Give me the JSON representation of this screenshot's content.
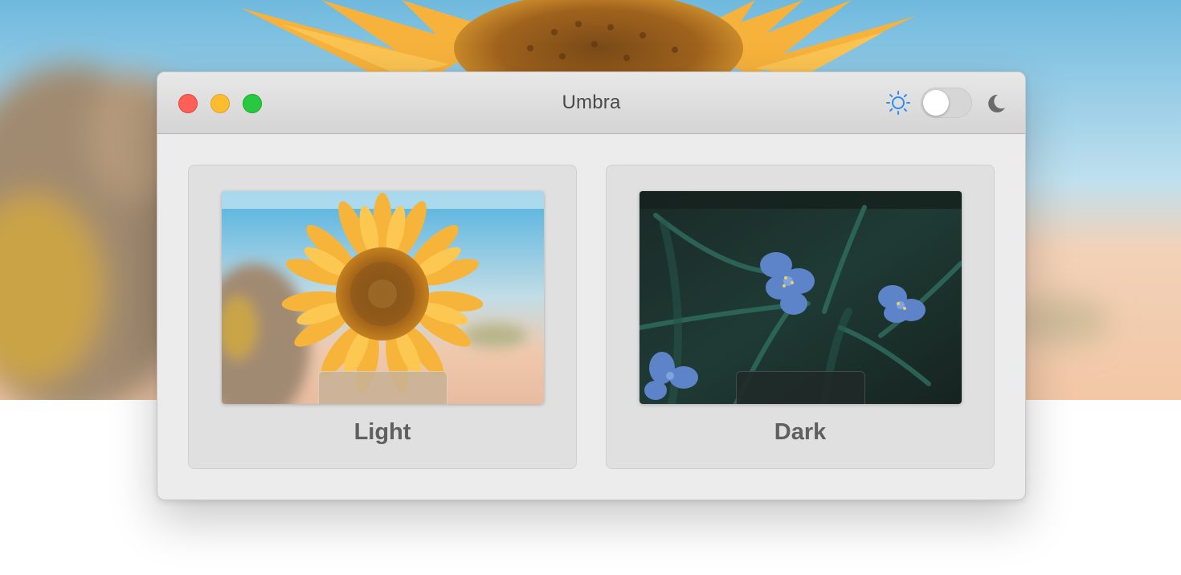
{
  "window": {
    "title": "Umbra"
  },
  "appearance_toggle": {
    "state": "light",
    "left_icon": "sun-icon",
    "right_icon": "moon-icon",
    "accent": "#2f8cf5"
  },
  "options": [
    {
      "label": "Light",
      "preview": "sunflower"
    },
    {
      "label": "Dark",
      "preview": "blue-flowers"
    }
  ],
  "colors": {
    "close": "#fe5f57",
    "minimize": "#febc2e",
    "maximize": "#28c840"
  }
}
